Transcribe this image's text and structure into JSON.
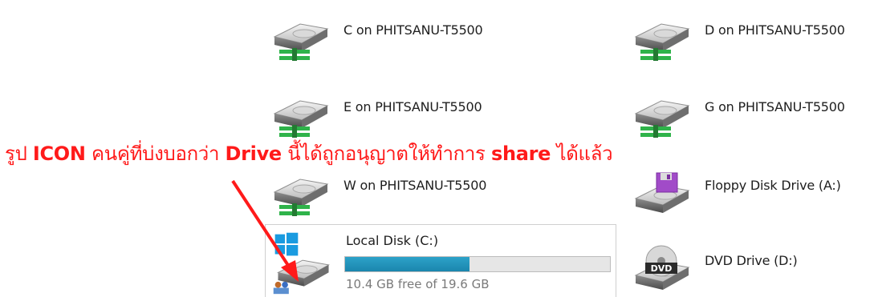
{
  "drives": [
    {
      "label": "C on PHITSANU-T5500",
      "icon": "network-drive-icon"
    },
    {
      "label": "D on PHITSANU-T5500",
      "icon": "network-drive-icon"
    },
    {
      "label": "E on PHITSANU-T5500",
      "icon": "network-drive-icon"
    },
    {
      "label": "G on PHITSANU-T5500",
      "icon": "network-drive-icon"
    },
    {
      "label": "W on PHITSANU-T5500",
      "icon": "network-drive-icon"
    },
    {
      "label": "Floppy Disk Drive (A:)",
      "icon": "floppy-drive-icon"
    },
    {
      "label": "DVD Drive (D:)",
      "icon": "dvd-drive-icon",
      "badge": "DVD"
    }
  ],
  "local_disk": {
    "label": "Local Disk (C:)",
    "free_text": "10.4 GB free of 19.6 GB",
    "used_fraction": 0.47,
    "icon": "windows-drive-icon"
  },
  "annotation": {
    "part1": "รูป ",
    "part2": "ICON",
    "part3": " คนคู่ที่บ่งบอกว่า ",
    "part4": "Drive",
    "part5": " นี้ได้ถูกอนุญาตให้ทำการ ",
    "part6": "share",
    "part7": " ได้แล้ว"
  },
  "colors": {
    "annotation": "#ff1a1a",
    "usage_bar": "#26a0da",
    "drive_green": "#2fb34a"
  }
}
